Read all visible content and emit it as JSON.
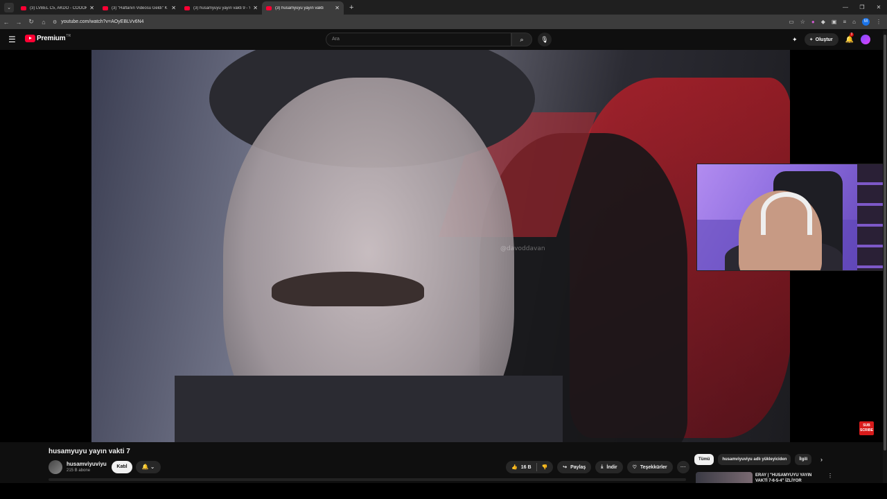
{
  "browser": {
    "tabs": [
      {
        "title": "(3) LVBEL C5, AKDO - COOOK",
        "active": false
      },
      {
        "title": "(3) \"Haftanın Videosu Geldi\" K",
        "active": false
      },
      {
        "title": "(3) husamyuyu yayın vakti 9 - Y",
        "active": false
      },
      {
        "title": "(3) husamyuyu yayın vakti",
        "active": true
      }
    ],
    "url": "youtube.com/watch?v=AOyEBLVv6N4",
    "profile_initial": "M"
  },
  "youtube": {
    "brand": "Premium",
    "region": "TR",
    "search_placeholder": "Ara",
    "create_label": "Oluştur",
    "notification_count": "3"
  },
  "video": {
    "watermark": "@davoddavan",
    "subscribe_badge": "SUB SCRIBE",
    "title": "husamyuyu yayın vakti 7",
    "channel": "husamviyuviyu",
    "subscribers": "215 B abone",
    "join_label": "Katıl",
    "likes": "16 B",
    "share_label": "Paylaş",
    "download_label": "İndir",
    "thanks_label": "Teşekkürler"
  },
  "sidebar": {
    "chips": [
      "Tümü",
      "husamviyuviyu adlı yükleyiciden",
      "İlgili"
    ],
    "rec_title": "ERAY | \"HUSAMYUYU YAYIN VAKTİ 7-6-5-4\" İZLİYOR"
  }
}
